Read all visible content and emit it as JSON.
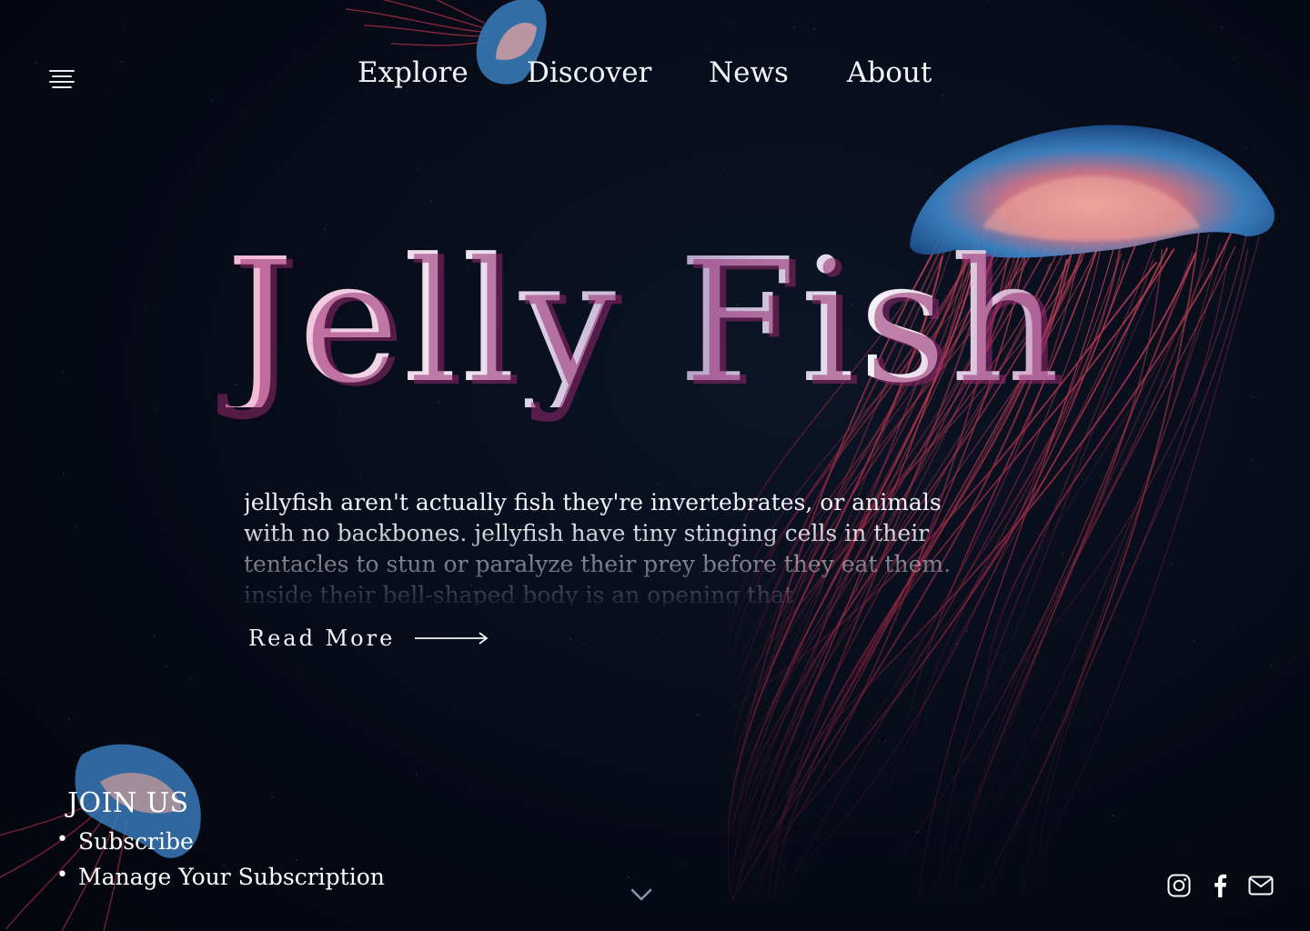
{
  "nav": {
    "items": [
      "Explore",
      "Discover",
      "News",
      "About"
    ]
  },
  "hero": {
    "title": "Jelly Fish",
    "paragraph": "jellyfish aren't actually fish they're invertebrates, or animals with no backbones. jellyfish have tiny stinging cells in their tentacles to stun or paralyze their prey before they eat them. inside their bell-shaped body is an opening that",
    "read_more": "Read More"
  },
  "join": {
    "heading": "JOIN US",
    "links": [
      "Subscribe",
      "Manage Your Subscription"
    ]
  },
  "icons": {
    "menu": "hamburger-menu-icon",
    "arrow": "arrow-right-icon",
    "scroll": "chevron-down-icon",
    "social": [
      "instagram-icon",
      "facebook-icon",
      "mail-icon"
    ]
  },
  "colors": {
    "background": "#070b17",
    "jelly_bell": "#2b7fc8",
    "jelly_tentacles": "#c8344f",
    "title_pink": "#f3b7d3",
    "text": "#ffffff"
  }
}
